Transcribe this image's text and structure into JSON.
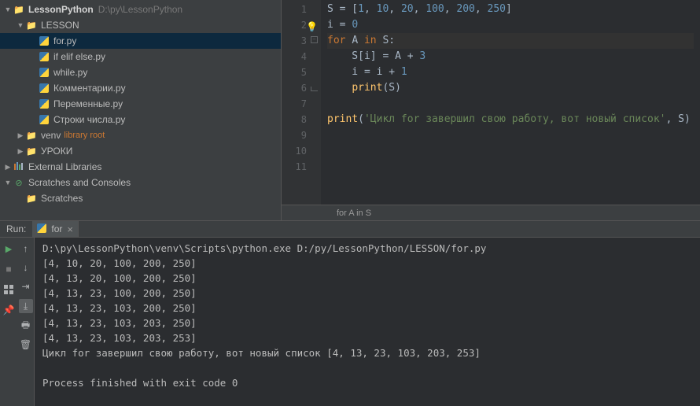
{
  "project": {
    "root_name": "LessonPython",
    "root_path": "D:\\py\\LessonPython",
    "lesson_folder": "LESSON",
    "files": [
      "for.py",
      "if elif else.py",
      "while.py",
      "Комментарии.py",
      "Переменные.py",
      "Строки числа.py"
    ],
    "venv": "venv",
    "venv_tag": "library root",
    "uroki": "УРОКИ",
    "ext_libs": "External Libraries",
    "scratches": "Scratches and Consoles",
    "scratches_sub": "Scratches"
  },
  "editor": {
    "lines": [
      {
        "n": 1,
        "tokens": [
          {
            "t": "S",
            "c": "var"
          },
          {
            "t": " = [",
            "c": "op"
          },
          {
            "t": "1",
            "c": "num"
          },
          {
            "t": ", ",
            "c": "op"
          },
          {
            "t": "10",
            "c": "num"
          },
          {
            "t": ", ",
            "c": "op"
          },
          {
            "t": "20",
            "c": "num"
          },
          {
            "t": ", ",
            "c": "op"
          },
          {
            "t": "100",
            "c": "num"
          },
          {
            "t": ", ",
            "c": "op"
          },
          {
            "t": "200",
            "c": "num"
          },
          {
            "t": ", ",
            "c": "op"
          },
          {
            "t": "250",
            "c": "num"
          },
          {
            "t": "]",
            "c": "op"
          }
        ]
      },
      {
        "n": 2,
        "bulb": true,
        "tokens": [
          {
            "t": "i",
            "c": "var"
          },
          {
            "t": " = ",
            "c": "op"
          },
          {
            "t": "0",
            "c": "num"
          }
        ]
      },
      {
        "n": 3,
        "fold": true,
        "current": true,
        "tokens": [
          {
            "t": "for ",
            "c": "kw"
          },
          {
            "t": "A",
            "c": "var"
          },
          {
            "t": " in ",
            "c": "kw"
          },
          {
            "t": "S:",
            "c": "var"
          }
        ]
      },
      {
        "n": 4,
        "tokens": [
          {
            "t": "    S[i] = A + ",
            "c": "var"
          },
          {
            "t": "3",
            "c": "num"
          }
        ]
      },
      {
        "n": 5,
        "tokens": [
          {
            "t": "    i = i + ",
            "c": "var"
          },
          {
            "t": "1",
            "c": "num"
          }
        ]
      },
      {
        "n": 6,
        "fold_end": true,
        "tokens": [
          {
            "t": "    ",
            "c": "var"
          },
          {
            "t": "print",
            "c": "fn"
          },
          {
            "t": "(S)",
            "c": "var"
          }
        ]
      },
      {
        "n": 7,
        "tokens": []
      },
      {
        "n": 8,
        "tokens": [
          {
            "t": "print",
            "c": "fn"
          },
          {
            "t": "(",
            "c": "var"
          },
          {
            "t": "'Цикл for завершил свою работу, вот новый список'",
            "c": "str"
          },
          {
            "t": ", ",
            "c": "op"
          },
          {
            "t": "S)",
            "c": "var"
          }
        ]
      },
      {
        "n": 9,
        "tokens": []
      },
      {
        "n": 10,
        "tokens": []
      },
      {
        "n": 11,
        "tokens": []
      }
    ],
    "breadcrumb": "for A in S"
  },
  "run": {
    "label": "Run:",
    "tab": "for",
    "output": "D:\\py\\LessonPython\\venv\\Scripts\\python.exe D:/py/LessonPython/LESSON/for.py\n[4, 10, 20, 100, 200, 250]\n[4, 13, 20, 100, 200, 250]\n[4, 13, 23, 100, 200, 250]\n[4, 13, 23, 103, 200, 250]\n[4, 13, 23, 103, 203, 250]\n[4, 13, 23, 103, 203, 253]\nЦикл for завершил свою работу, вот новый список [4, 13, 23, 103, 203, 253]\n\nProcess finished with exit code 0"
  }
}
